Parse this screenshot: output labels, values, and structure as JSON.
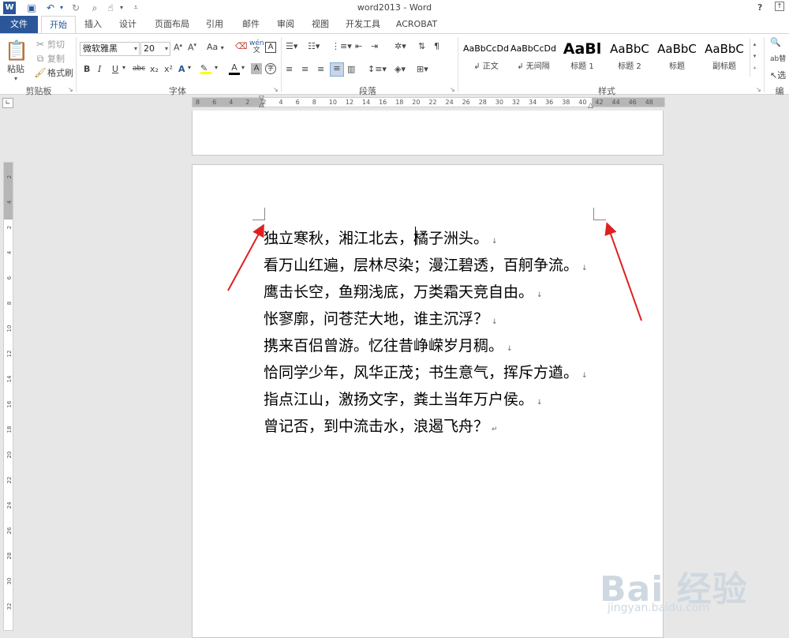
{
  "window": {
    "title": "word2013 - Word",
    "help": "?"
  },
  "tabs": [
    "文件",
    "开始",
    "插入",
    "设计",
    "页面布局",
    "引用",
    "邮件",
    "审阅",
    "视图",
    "开发工具",
    "ACROBAT"
  ],
  "clipboard": {
    "paste": "粘贴",
    "cut": "剪切",
    "copy": "复制",
    "format_painter": "格式刷",
    "label": "剪贴板"
  },
  "font": {
    "name": "微软雅黑",
    "size": "20",
    "label": "字体",
    "case": "Aa",
    "phonetic": "wén",
    "strikethrough": "abc",
    "subscript": "x₂",
    "superscript": "x²"
  },
  "paragraph": {
    "label": "段落"
  },
  "styles": {
    "label": "样式",
    "items": [
      {
        "sample": "AaBbCcDd",
        "name": "↲ 正文"
      },
      {
        "sample": "AaBbCcDd",
        "name": "↲ 无间隔"
      },
      {
        "sample": "AaBl",
        "name": "标题 1"
      },
      {
        "sample": "AaBbC",
        "name": "标题 2"
      },
      {
        "sample": "AaBbC",
        "name": "标题"
      },
      {
        "sample": "AaBbC",
        "name": "副标题"
      }
    ]
  },
  "editing": {
    "label": "编",
    "replace": "替",
    "select": "选"
  },
  "ruler_h": [
    "8",
    "6",
    "4",
    "2",
    "2",
    "4",
    "6",
    "8",
    "10",
    "12",
    "14",
    "16",
    "18",
    "20",
    "22",
    "24",
    "26",
    "28",
    "30",
    "32",
    "34",
    "36",
    "38",
    "40",
    "42",
    "44",
    "46",
    "48"
  ],
  "ruler_v": [
    "2",
    "4",
    "2",
    "4",
    "6",
    "8",
    "10",
    "12",
    "14",
    "16",
    "18",
    "20",
    "22",
    "24",
    "26",
    "28",
    "30",
    "32"
  ],
  "document": {
    "lines": [
      "独立寒秋，湘江北去，橘子洲头。",
      "看万山红遍，层林尽染；漫江碧透，百舸争流。",
      "鹰击长空，鱼翔浅底，万类霜天竞自由。",
      "怅寥廓，问苍茫大地，谁主沉浮？",
      "携来百侣曾游。忆往昔峥嵘岁月稠。",
      "恰同学少年，风华正茂；书生意气，挥斥方遒。",
      "指点江山，激扬文字，粪土当年万户侯。",
      "曾记否，到中流击水，浪遏飞舟？"
    ],
    "para_mark": "↓",
    "end_mark": "↵"
  },
  "watermark": {
    "big": "Bai 经验",
    "small": "jingyan.baidu.com"
  },
  "colors": {
    "accent": "#2b579a",
    "arrow": "#e02020"
  }
}
